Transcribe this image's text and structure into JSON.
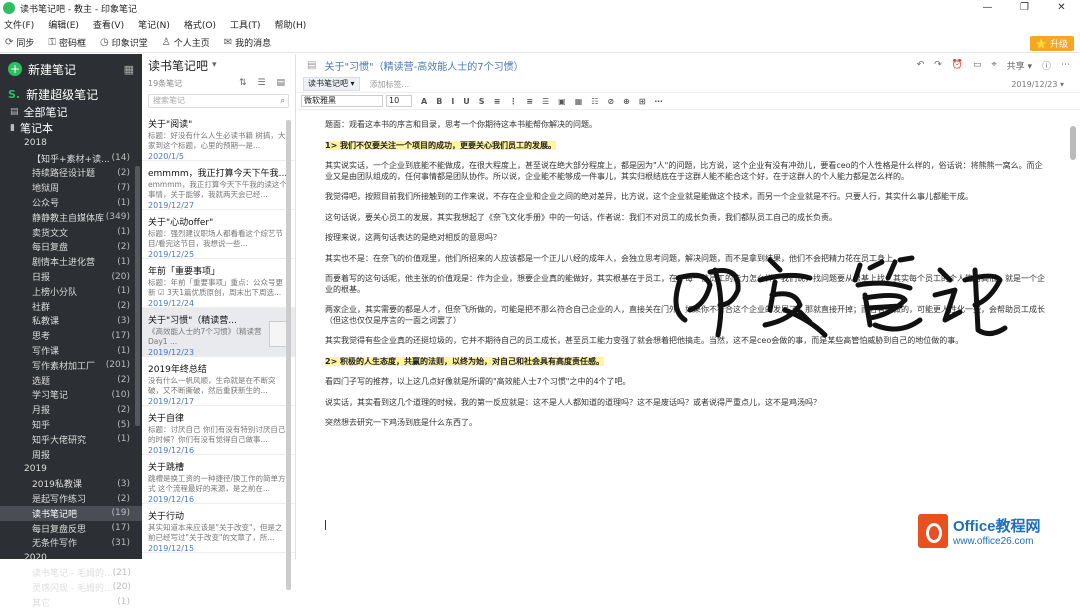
{
  "window": {
    "title": "读书笔记吧 - 教主 - 印象笔记",
    "controls": [
      "—",
      "❐",
      "✕"
    ]
  },
  "menu": [
    "文件(F)",
    "编辑(E)",
    "查看(V)",
    "笔记(N)",
    "格式(O)",
    "工具(T)",
    "帮助(H)"
  ],
  "toolbar": [
    {
      "label": "同步",
      "icon": "sync-icon",
      "glyph": "⟳"
    },
    {
      "label": "密码框",
      "icon": "lock-icon",
      "glyph": "⚿"
    },
    {
      "label": "印象识堂",
      "icon": "clock-icon",
      "glyph": "◷"
    },
    {
      "label": "个人主页",
      "icon": "person-icon",
      "glyph": "♙"
    },
    {
      "label": "我的消息",
      "icon": "message-icon",
      "glyph": "✉"
    }
  ],
  "upgrade": "⭐ 升级",
  "sidebar": {
    "new_note": "新建笔记",
    "super_note": "新建超级笔记",
    "all_notes": "全部笔记",
    "notebooks": "笔记本",
    "rows": [
      {
        "label": "2018",
        "count": "",
        "kind": "year"
      },
      {
        "label": "【知乎+素材+读...",
        "count": "(14)"
      },
      {
        "label": "持续路径设计题",
        "count": "(2)"
      },
      {
        "label": "地狱周",
        "count": "(7)"
      },
      {
        "label": "公众号",
        "count": "(1)"
      },
      {
        "label": "静静教主自媒体库",
        "count": "(349)"
      },
      {
        "label": "卖货文文",
        "count": "(1)"
      },
      {
        "label": "每日复盘",
        "count": "(2)"
      },
      {
        "label": "剧情本土进化营",
        "count": "(1)"
      },
      {
        "label": "日报",
        "count": "(20)"
      },
      {
        "label": "上榜小分队",
        "count": "(1)"
      },
      {
        "label": "社群",
        "count": "(2)"
      },
      {
        "label": "私教课",
        "count": "(3)"
      },
      {
        "label": "思考",
        "count": "(17)"
      },
      {
        "label": "写作课",
        "count": "(1)"
      },
      {
        "label": "写作素材加工厂",
        "count": "(201)"
      },
      {
        "label": "选题",
        "count": "(2)"
      },
      {
        "label": "学习笔记",
        "count": "(10)"
      },
      {
        "label": "月报",
        "count": "(2)"
      },
      {
        "label": "知乎",
        "count": "(5)"
      },
      {
        "label": "知乎大佬研究",
        "count": "(1)"
      },
      {
        "label": "周报",
        "count": ""
      },
      {
        "label": "2019",
        "count": "",
        "kind": "year"
      },
      {
        "label": "2019私教课",
        "count": "(3)"
      },
      {
        "label": "是起写作练习",
        "count": "(2)"
      },
      {
        "label": "读书笔记吧",
        "count": "(19)",
        "selected": true
      },
      {
        "label": "每日复盘反思",
        "count": "(17)"
      },
      {
        "label": "无条件写作",
        "count": "(31)"
      },
      {
        "label": "2020",
        "count": "",
        "kind": "year"
      },
      {
        "label": "读书笔记 - 毛姆的...",
        "count": "(21)"
      },
      {
        "label": "灵感闪现 - 毛姆的...",
        "count": "(20)"
      },
      {
        "label": "其它",
        "count": "(1)"
      }
    ]
  },
  "notelist": {
    "title": "读书笔记吧",
    "count": "19条笔记",
    "icons": "⇅ ☰ ▤",
    "search_placeholder": "搜索笔记",
    "notes": [
      {
        "title": "关于\"阅读\"",
        "preview": "标题：好没有什么人生必读书籍 树搞，大家到这个标题，心里的预期一是...",
        "date": "2020/1/5"
      },
      {
        "title": "emmmm，我正打算今天下午我...",
        "preview": "emmmm，我正打算今天下午我的读这个事情，关于能够，我就两天会已经...",
        "date": "2019/12/27"
      },
      {
        "title": "关于\"心动offer\"",
        "preview": "标题：强烈建议职场人都看看这个综艺节目/看完这节目，我想说一些...",
        "date": "2019/12/25"
      },
      {
        "title": "年前「重要事项」",
        "preview": "标题：年前「重要事项」重点：公众号更新 ☑ 3天1篇优质原创，周末出下周选...",
        "date": "2019/12/24"
      },
      {
        "title": "关于\"习惯\"（精读营...",
        "preview": "《高效能人士的7个习惯》（精读营Day1 ...",
        "date": "2019/12/23",
        "selected": true,
        "thumb": true
      },
      {
        "title": "2019年终总结",
        "preview": "没有什么一帆风顺，生命就是在不断突破，又不断撕破，然后重获新生的...",
        "date": "2019/12/17"
      },
      {
        "title": "关于自律",
        "preview": "标题：讨厌自己 你们有没有特别讨厌自己的时候？你们有没有觉得自己做事...",
        "date": "2019/12/16"
      },
      {
        "title": "关于跳槽",
        "preview": "跳槽是换工资的一种捷径/换工作的简单方式 这个流程最好的来源，是之前在...",
        "date": "2019/12/16"
      },
      {
        "title": "关于行动",
        "preview": "其实知道本来应该是\"关于改变\"，但是之前已经写过\"关于改变\"的文章了，所...",
        "date": "2019/12/15"
      }
    ]
  },
  "editor": {
    "title": "关于\"习惯\"（精读营-高效能人士的7个习惯）",
    "tools": [
      "↶",
      "↷",
      "⏰",
      "▭",
      "⌖",
      "共享 ▾",
      "ⓘ",
      "⋯"
    ],
    "notebook": "读书笔记吧 ▾",
    "tag_placeholder": "添加标签...",
    "date": "2019/12/23 ▾",
    "font": "微软雅黑",
    "size": "10",
    "format_buttons": [
      "A",
      "B",
      "I",
      "U",
      "S",
      "≡",
      "⋮",
      "≡",
      "☰",
      "▣",
      "▦",
      "☷",
      "⊘",
      "⊕",
      "⊞",
      "⋯"
    ],
    "paragraphs": [
      {
        "text": "题面：观看这本书的序言和目录，思考一个你期待这本书能帮你解决的问题。"
      },
      {
        "text": "1> 我们不仅要关注一个项目的成功，更要关心我们员工的发展。",
        "highlight": true
      },
      {
        "text": "其实说实话，一个企业到底能不能做成，在很大程度上，甚至说在绝大部分程度上，都是因为\"人\"的问题，比方说，这个企业有没有冲劲儿，要看ceo的个人性格是什么样的，俗话说：将熊熊一窝么。而企业又是由团队组成的，任何事情都是团队协作。所以说，企业能不能够成一件事儿，其实归根结底在于这群人能不能合这个好，在于这群人的个人能力都是怎么样的。"
      },
      {
        "text": "我觉得吧，按照目前我们所接触到的工作来说，不存在企业和企业之间的绝对差异，比方说，这个企业就是能做这个技术，而另一个企业就是不行。只要人行，其实什么事儿都能干成。"
      },
      {
        "text": "这句话说，要关心员工的发展，其实我想起了《奈飞文化手册》中的一句话，作者说：我们不对员工的成长负责，我们都队员工自己的成长负责。"
      },
      {
        "text": "按理来说，这两句话表达的是绝对相反的意思吗？"
      },
      {
        "text": "其实也不是：在奈飞的价值观里，他们所招来的人应该都是一个正儿八经的成年人，会独立思考问题，解决问题，而不是拿到结果，他们不会把精力花在员工身上。"
      },
      {
        "text": "而要着写的这句话呢，他主张的价值观是：作为企业，想要企业真的能做好，其实根基在于员工，在于每一位员工的能力怎么样。我们说，找问题要从根基上找，其实每个员工的个人能力高低，就是一个企业的根基。"
      },
      {
        "text": "两家企业，其实需要的都是人才，但奈飞所做的，可能是把不那么符合自己企业的人，直接关在门外，如果你不符合这个企业的发展了，那就直接开掉；而后者所做的，可能更人性化一些，会帮助员工成长（但这也仅仅是序言的一面之词罢了）"
      },
      {
        "text": "其实我觉得有些企业真的还挺垃圾的，它并不期待自己的员工成长，甚至员工能力变强了就会想着把他搞走。当然，这不是ceo会做的事，而是某些高管怕威胁到自己的地位做的事。"
      },
      {
        "text": "2> 积极的人生态度，共赢的法则，以终为始，对自己和社会具有高度责任感。",
        "highlight": true
      },
      {
        "text": "看四门子写的推荐，以上这几点好像就是所谓的\"高效能人士7个习惯\"之中的4个了吧。"
      },
      {
        "text": "说实话，其实看到这几个道理的时候，我的第一反应就是：这不是人人都知道的道理吗？这不是废话吗？或者说得严重点儿，这不是鸡汤吗？"
      },
      {
        "text": "突然想去研究一下鸡汤到底是什么东西了。"
      }
    ]
  },
  "watermark": "印象笔记",
  "brand": {
    "name": "Office教程网",
    "url": "www.office26.com",
    "color": "#1e6fbf",
    "accent": "#e8501f"
  }
}
